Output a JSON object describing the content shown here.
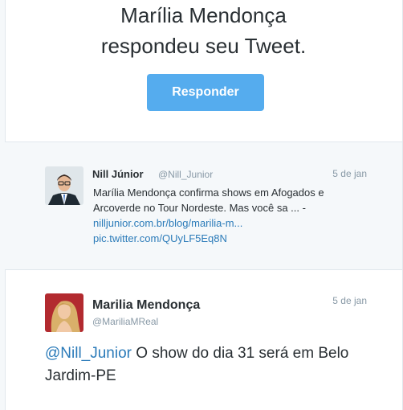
{
  "notification": {
    "line1": "Marília Mendonça",
    "line2": "respondeu seu Tweet.",
    "button_label": "Responder",
    "button_color": "#55acee"
  },
  "quoted_tweet": {
    "name": "Nill Júnior",
    "handle": "@Nill_Junior",
    "date": "5 de jan",
    "text": "Marília Mendonça confirma shows em Afogados e Arcoverde no Tour Nordeste. Mas você sa ... -",
    "link1": "nilljunior.com.br/blog/marilia-m...",
    "link2": "pic.twitter.com/QUyLF5Eq8N",
    "avatar_icon": "user-avatar-nill"
  },
  "reply_tweet": {
    "name": "Marilia Mendonça",
    "handle": "@MariliaMReal",
    "date": "5 de jan",
    "mention": "@Nill_Junior",
    "text": " O show do dia 31 será em Belo Jardim-PE",
    "avatar_icon": "user-avatar-marilia"
  },
  "colors": {
    "link": "#2b7bb9",
    "muted": "#8899a6",
    "text": "#292f33",
    "quoted_bg": "#f5f8fa"
  }
}
